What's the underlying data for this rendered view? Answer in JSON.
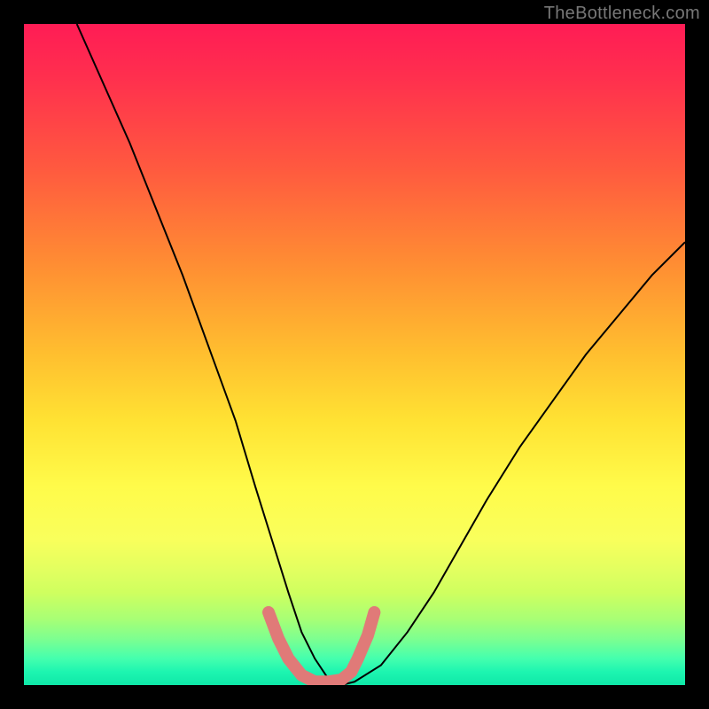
{
  "watermark": "TheBottleneck.com",
  "chart_data": {
    "type": "line",
    "title": "",
    "xlabel": "",
    "ylabel": "",
    "xlim": [
      0,
      100
    ],
    "ylim": [
      0,
      100
    ],
    "grid": false,
    "legend": false,
    "background_gradient": {
      "orientation": "vertical",
      "stops": [
        {
          "pos": 0.0,
          "color": "#ff1c55"
        },
        {
          "pos": 0.22,
          "color": "#ff5a3f"
        },
        {
          "pos": 0.5,
          "color": "#ffbf2f"
        },
        {
          "pos": 0.7,
          "color": "#fffb4a"
        },
        {
          "pos": 0.86,
          "color": "#cfff5f"
        },
        {
          "pos": 0.96,
          "color": "#44ffae"
        },
        {
          "pos": 1.0,
          "color": "#0fe8a8"
        }
      ]
    },
    "series": [
      {
        "name": "curve_black",
        "color": "#000000",
        "stroke_width": 2,
        "x": [
          8,
          12,
          16,
          20,
          24,
          28,
          32,
          35,
          37.5,
          40,
          42,
          44,
          46,
          48,
          50,
          54,
          58,
          62,
          66,
          70,
          75,
          80,
          85,
          90,
          95,
          100
        ],
        "y": [
          100,
          91,
          82,
          72,
          62,
          51,
          40,
          30,
          22,
          14,
          8,
          4,
          1,
          0,
          0.5,
          3,
          8,
          14,
          21,
          28,
          36,
          43,
          50,
          56,
          62,
          67
        ]
      },
      {
        "name": "marker_pink",
        "color": "#e07a78",
        "stroke_width": 14,
        "linecap": "round",
        "x": [
          37,
          38.5,
          40,
          42,
          44,
          46,
          48,
          49.5,
          50.5,
          52,
          53
        ],
        "y": [
          11,
          7,
          4,
          1.5,
          0.5,
          0.5,
          0.8,
          2,
          4,
          7.5,
          11
        ]
      }
    ]
  }
}
